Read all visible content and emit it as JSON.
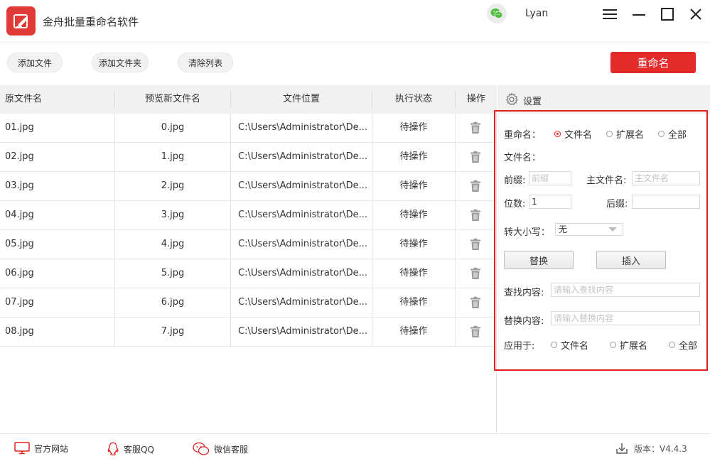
{
  "app": {
    "title": "金舟批量重命名软件",
    "user": "Lyan"
  },
  "toolbar": {
    "add_file": "添加文件",
    "add_folder": "添加文件夹",
    "clear_list": "清除列表",
    "rename": "重命名"
  },
  "table": {
    "headers": [
      "原文件名",
      "预览新文件名",
      "文件位置",
      "执行状态",
      "操作"
    ],
    "rows": [
      {
        "orig": "01.jpg",
        "preview": "0.jpg",
        "path": "C:\\Users\\Administrator\\De...",
        "status": "待操作"
      },
      {
        "orig": "02.jpg",
        "preview": "1.jpg",
        "path": "C:\\Users\\Administrator\\De...",
        "status": "待操作"
      },
      {
        "orig": "03.jpg",
        "preview": "2.jpg",
        "path": "C:\\Users\\Administrator\\De...",
        "status": "待操作"
      },
      {
        "orig": "04.jpg",
        "preview": "3.jpg",
        "path": "C:\\Users\\Administrator\\De...",
        "status": "待操作"
      },
      {
        "orig": "05.jpg",
        "preview": "4.jpg",
        "path": "C:\\Users\\Administrator\\De...",
        "status": "待操作"
      },
      {
        "orig": "06.jpg",
        "preview": "5.jpg",
        "path": "C:\\Users\\Administrator\\De...",
        "status": "待操作"
      },
      {
        "orig": "07.jpg",
        "preview": "6.jpg",
        "path": "C:\\Users\\Administrator\\De...",
        "status": "待操作"
      },
      {
        "orig": "08.jpg",
        "preview": "7.jpg",
        "path": "C:\\Users\\Administrator\\De...",
        "status": "待操作"
      }
    ]
  },
  "settings": {
    "title": "设置",
    "rename_label": "重命名：",
    "target_options": [
      "文件名",
      "扩展名",
      "全部"
    ],
    "selected_target": "文件名",
    "filename_label": "文件名：",
    "prefix_label": "前缀:",
    "prefix_placeholder": "前缀",
    "main_name_label": "主文件名:",
    "main_name_placeholder": "主文件名",
    "digits_label": "位数:",
    "digits_value": "1",
    "suffix_label": "后缀:",
    "suffix_value": "",
    "case_label": "转大小写：",
    "case_value": "无",
    "replace_btn": "替换",
    "insert_btn": "插入",
    "find_label": "查找内容:",
    "find_placeholder": "请输入查找内容",
    "replace_label": "替换内容:",
    "replace_placeholder": "请输入替换内容",
    "apply_label": "应用于:",
    "apply_options": [
      "文件名",
      "扩展名",
      "全部"
    ]
  },
  "footer": {
    "website": "官方网站",
    "qq": "客服QQ",
    "wechat": "微信客服",
    "version": "版本：V4.4.3"
  },
  "colors": {
    "accent": "#e32b2b",
    "header_bg": "#f1f1f1"
  }
}
